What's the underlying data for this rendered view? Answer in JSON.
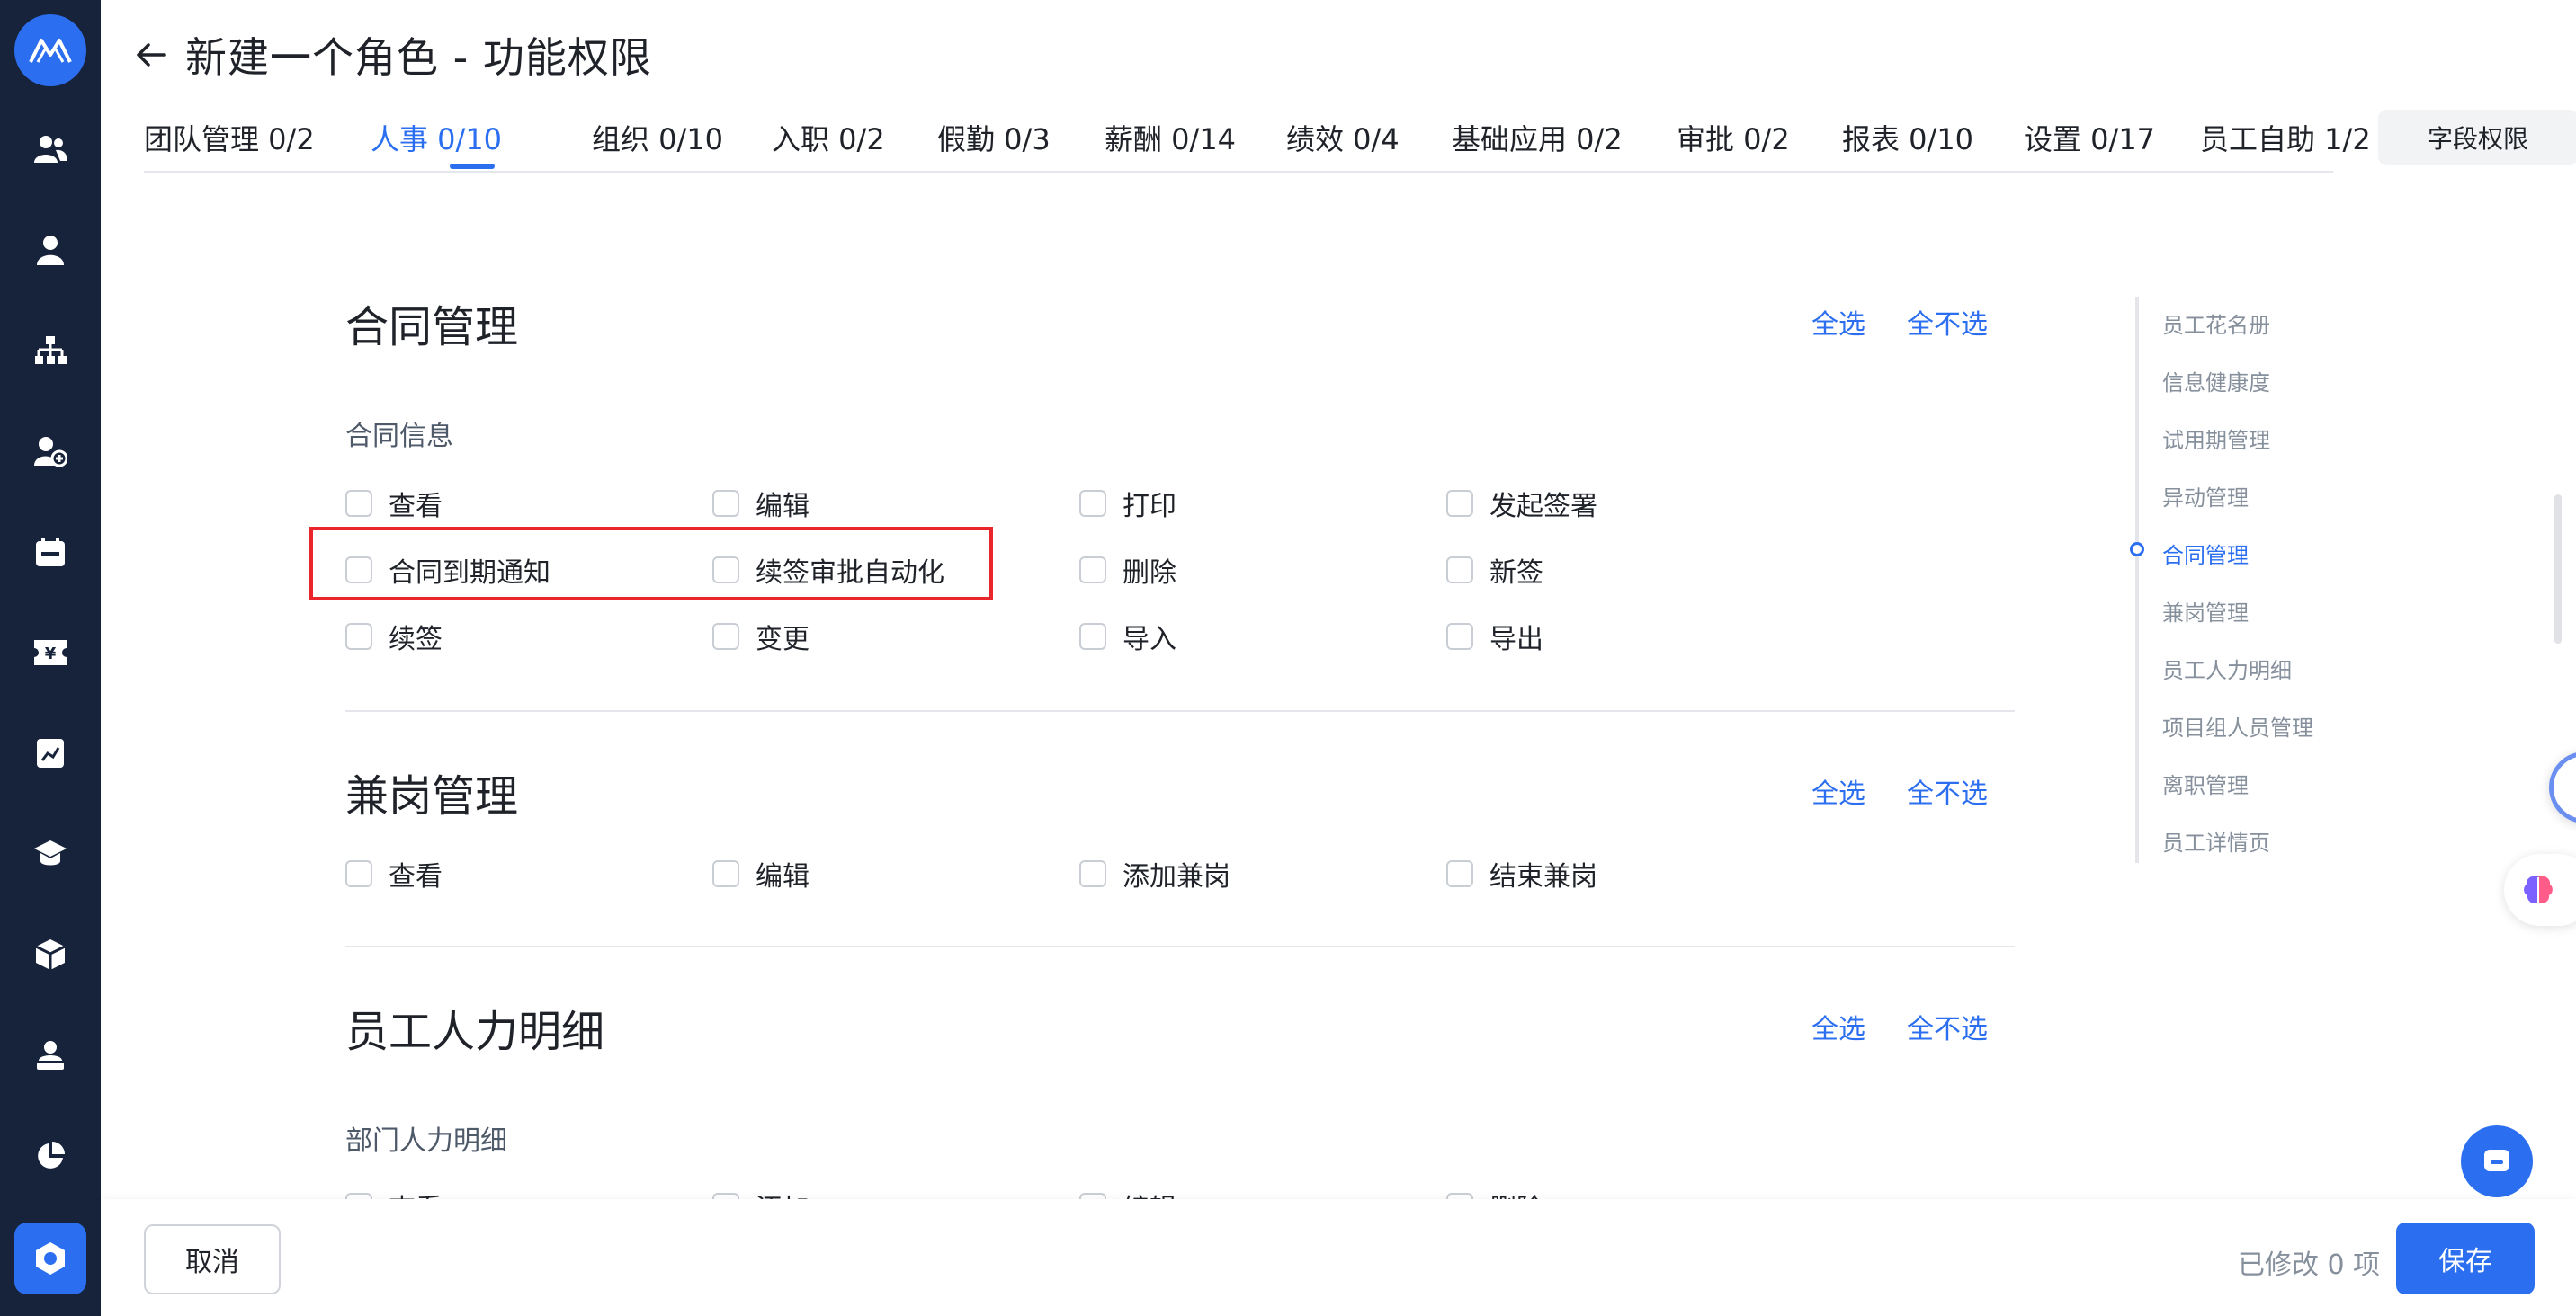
{
  "header": {
    "title": "新建一个角色 - 功能权限"
  },
  "tabs": [
    {
      "label": "团队管理 0/2"
    },
    {
      "label": "人事 0/10"
    },
    {
      "label": "组织 0/10"
    },
    {
      "label": "入职 0/2"
    },
    {
      "label": "假勤 0/3"
    },
    {
      "label": "薪酬 0/14"
    },
    {
      "label": "绩效 0/4"
    },
    {
      "label": "基础应用 0/2"
    },
    {
      "label": "审批 0/2"
    },
    {
      "label": "报表 0/10"
    },
    {
      "label": "设置 0/17"
    },
    {
      "label": "员工自助 1/2"
    }
  ],
  "active_tab": "人事 0/10",
  "field_permission_label": "字段权限",
  "select_all_label": "全选",
  "deselect_all_label": "全不选",
  "sections": [
    {
      "title": "合同管理",
      "subtitle": "合同信息",
      "items": [
        "查看",
        "编辑",
        "打印",
        "发起签署",
        "合同到期通知",
        "续签审批自动化",
        "删除",
        "新签",
        "续签",
        "变更",
        "导入",
        "导出"
      ]
    },
    {
      "title": "兼岗管理",
      "items": [
        "查看",
        "编辑",
        "添加兼岗",
        "结束兼岗"
      ]
    },
    {
      "title": "员工人力明细",
      "subtitle": "部门人力明细",
      "items": [
        "查看",
        "添加",
        "编辑",
        "删除"
      ]
    }
  ],
  "anchors": [
    "员工花名册",
    "信息健康度",
    "试用期管理",
    "异动管理",
    "合同管理",
    "兼岗管理",
    "员工人力明细",
    "项目组人员管理",
    "离职管理",
    "员工详情页"
  ],
  "active_anchor": "合同管理",
  "footer": {
    "cancel_label": "取消",
    "modified_text": "已修改 0 项",
    "save_label": "保存"
  },
  "colors": {
    "accent": "#2b6ff0",
    "sidebar": "#17233a",
    "highlight": "#e8262b"
  },
  "sidebar_icons": [
    "team-icon",
    "person-icon",
    "org-chart-icon",
    "user-add-icon",
    "calendar-icon",
    "salary-icon",
    "performance-icon",
    "training-icon",
    "box-icon",
    "user-badge-icon",
    "pie-chart-icon",
    "settings-icon"
  ]
}
